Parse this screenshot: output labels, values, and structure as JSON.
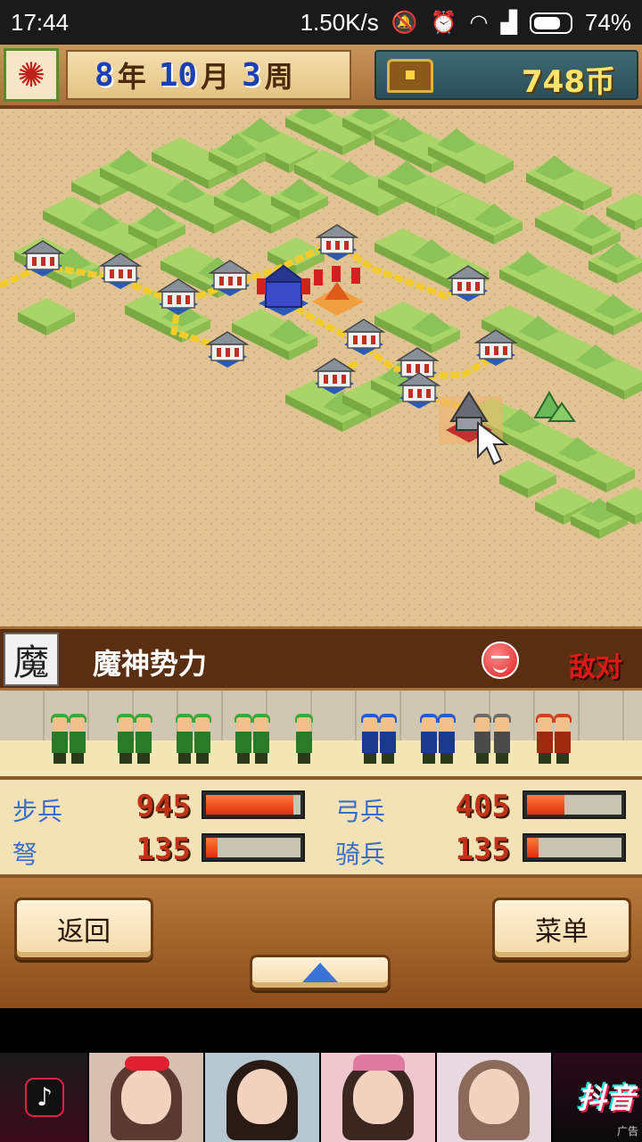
{
  "status_bar": {
    "time": "17:44",
    "net_speed": "1.50K/s",
    "battery_percent": "74%",
    "icons": [
      "mute-icon",
      "alarm-icon",
      "wifi-icon",
      "signal-icon",
      "battery-icon"
    ]
  },
  "top_bar": {
    "year_num": "8",
    "year_unit": "年",
    "month_num": "10",
    "month_unit": "月",
    "week_num": "3",
    "week_unit": "周",
    "coins": "748币"
  },
  "faction": {
    "kanji": "魔",
    "name": "魔神势力",
    "relation": "敌对"
  },
  "stats": {
    "infantry": {
      "label": "步兵",
      "value": "945",
      "level": 0.92
    },
    "archer": {
      "label": "弓兵",
      "value": "405",
      "level": 0.4
    },
    "crossbow": {
      "label": "弩",
      "value": "135",
      "level": 0.12
    },
    "cavalry": {
      "label": "骑兵",
      "value": "135",
      "level": 0.12
    }
  },
  "buttons": {
    "back": "返回",
    "menu": "菜单"
  },
  "ad": {
    "brand": "抖音",
    "tag": "广告"
  },
  "colors": {
    "accent_blue": "#1b3fb5",
    "coin_yellow": "#ffe36a",
    "hostile_red": "#e01818",
    "bar_orange": "#e03010"
  }
}
